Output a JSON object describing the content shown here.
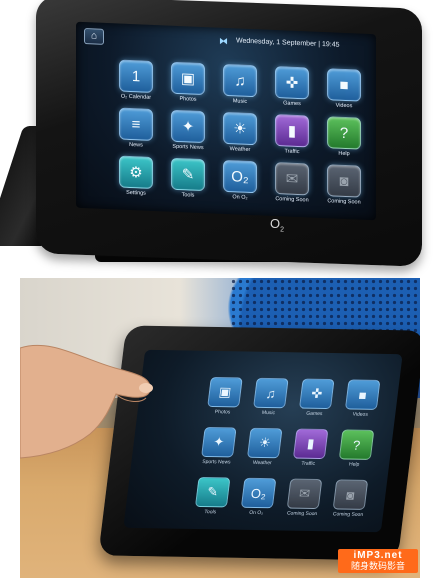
{
  "top_screen": {
    "home_icon": "home-icon",
    "date_text": "Wednesday, 1 September  | 19:45",
    "tiles": [
      {
        "label": "O₂ Calendar",
        "icon": "calendar-icon",
        "glyph": "1",
        "color": "blue"
      },
      {
        "label": "Photos",
        "icon": "photos-icon",
        "glyph": "▣",
        "color": "blue"
      },
      {
        "label": "Music",
        "icon": "music-icon",
        "glyph": "♫",
        "color": "blue"
      },
      {
        "label": "Games",
        "icon": "gamepad-icon",
        "glyph": "✜",
        "color": "blue"
      },
      {
        "label": "Videos",
        "icon": "video-camera-icon",
        "glyph": "■",
        "color": "blue"
      },
      {
        "label": "News",
        "icon": "newspaper-icon",
        "glyph": "≡",
        "color": "blue"
      },
      {
        "label": "Sports News",
        "icon": "runner-icon",
        "glyph": "✦",
        "color": "blue"
      },
      {
        "label": "Weather",
        "icon": "weather-icon",
        "glyph": "☀",
        "color": "blue"
      },
      {
        "label": "Traffic",
        "icon": "traffic-light-icon",
        "glyph": "▮",
        "color": "violet"
      },
      {
        "label": "Help",
        "icon": "help-icon",
        "glyph": "?",
        "color": "green"
      },
      {
        "label": "Settings",
        "icon": "gear-icon",
        "glyph": "⚙",
        "color": "teal"
      },
      {
        "label": "Tools",
        "icon": "tools-icon",
        "glyph": "✎",
        "color": "teal"
      },
      {
        "label": "On O₂",
        "icon": "o2-icon",
        "glyph": "O₂",
        "color": "blue"
      },
      {
        "label": "Coming Soon",
        "icon": "mail-icon",
        "glyph": "✉",
        "color": "gray"
      },
      {
        "label": "Coming Soon",
        "icon": "camera-icon",
        "glyph": "◙",
        "color": "gray"
      }
    ],
    "logo": "O₂"
  },
  "bottom_screen": {
    "tiles": [
      {
        "label": "Photos",
        "glyph": "▣",
        "color": "blue",
        "icon": "photos-icon"
      },
      {
        "label": "Music",
        "glyph": "♫",
        "color": "blue",
        "icon": "music-icon"
      },
      {
        "label": "Games",
        "glyph": "✜",
        "color": "blue",
        "icon": "gamepad-icon"
      },
      {
        "label": "Videos",
        "glyph": "■",
        "color": "blue",
        "icon": "video-camera-icon"
      },
      {
        "label": "Sports News",
        "glyph": "✦",
        "color": "blue",
        "icon": "runner-icon"
      },
      {
        "label": "Weather",
        "glyph": "☀",
        "color": "blue",
        "icon": "weather-icon"
      },
      {
        "label": "Traffic",
        "glyph": "▮",
        "color": "violet",
        "icon": "traffic-light-icon"
      },
      {
        "label": "Help",
        "glyph": "?",
        "color": "green",
        "icon": "help-icon"
      },
      {
        "label": "Tools",
        "glyph": "✎",
        "color": "teal",
        "icon": "tools-icon"
      },
      {
        "label": "On O₂",
        "glyph": "O₂",
        "color": "blue",
        "icon": "o2-icon"
      },
      {
        "label": "Coming Soon",
        "glyph": "✉",
        "color": "gray",
        "icon": "mail-icon"
      },
      {
        "label": "Coming Soon",
        "glyph": "◙",
        "color": "gray",
        "icon": "camera-icon"
      }
    ]
  },
  "watermark": {
    "line1": "iMP3.net",
    "line2": "随身数码影音"
  },
  "colors": {
    "tile_blue": "#2f7fc0",
    "tile_teal": "#1f9aa5",
    "tile_violet": "#7a44b5",
    "tile_green": "#3a9a3e",
    "tile_gray": "#444c57",
    "watermark": "#ff6a1a"
  }
}
